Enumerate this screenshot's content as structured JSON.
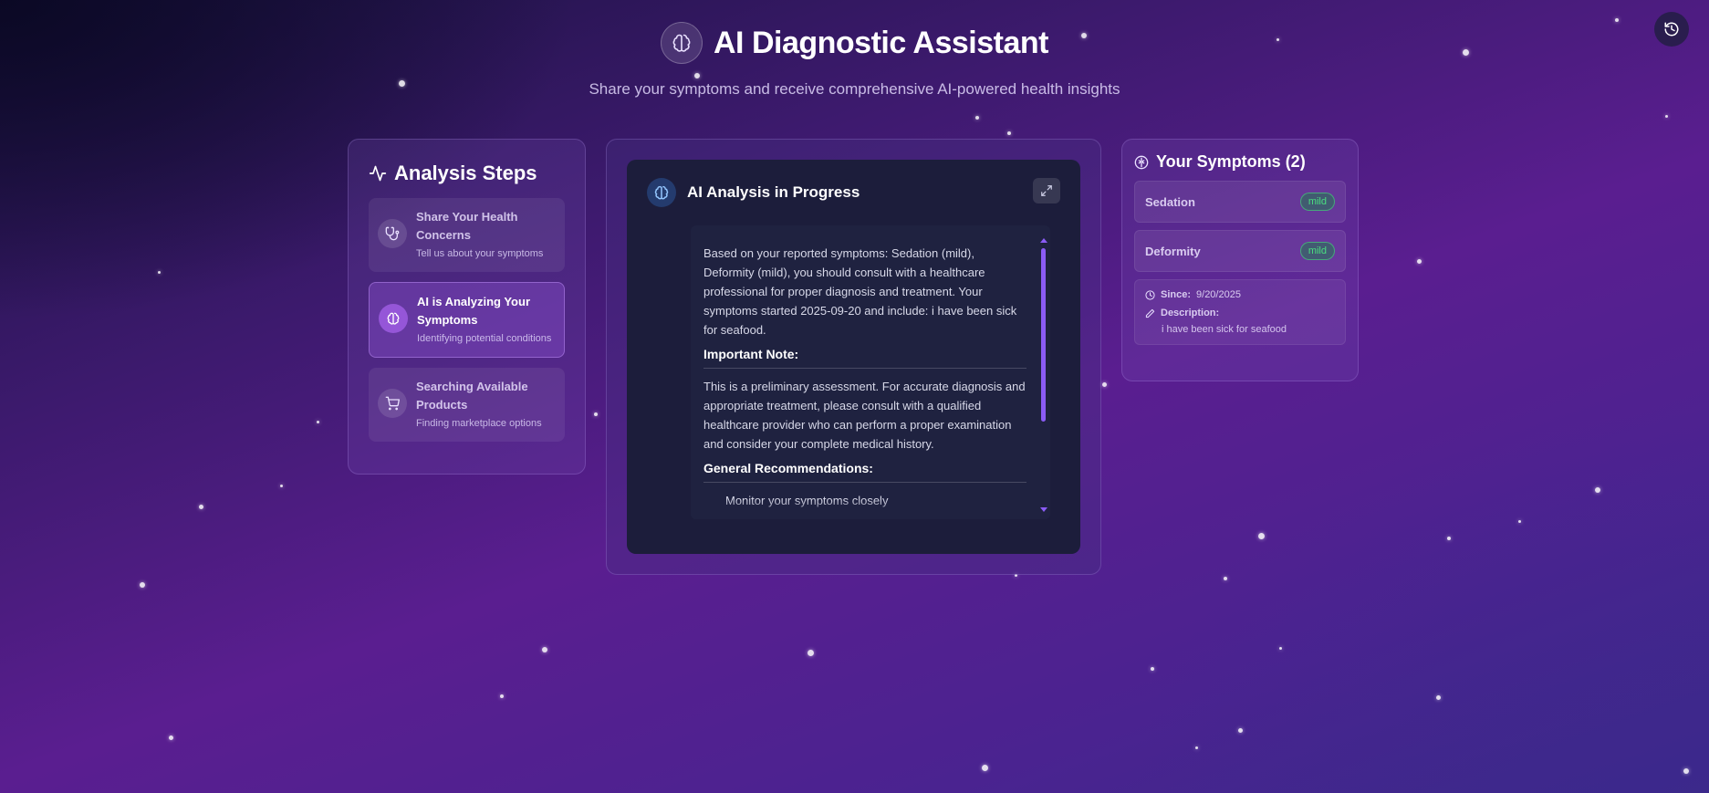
{
  "header": {
    "title": "AI Diagnostic Assistant",
    "subtitle": "Share your symptoms and receive comprehensive AI-powered health insights",
    "icon": "brain-icon"
  },
  "history_button": {
    "icon": "history-icon"
  },
  "steps": {
    "title": "Analysis Steps",
    "icon": "activity-icon",
    "items": [
      {
        "title": "Share Your Health Concerns",
        "desc": "Tell us about your symptoms",
        "icon": "stethoscope-icon",
        "active": false
      },
      {
        "title": "AI is Analyzing Your Symptoms",
        "desc": "Identifying potential conditions",
        "icon": "brain-icon",
        "active": true
      },
      {
        "title": "Searching Available Products",
        "desc": "Finding marketplace options",
        "icon": "cart-icon",
        "active": false
      }
    ]
  },
  "analysis": {
    "title": "AI Analysis in Progress",
    "expand_icon": "expand-icon",
    "intro": "Based on your reported symptoms: Sedation (mild), Deformity (mild), you should consult with a healthcare professional for proper diagnosis and treatment. Your symptoms started 2025-09-20 and include: i have been sick for seafood.",
    "note_heading": "Important Note:",
    "note_text": "This is a preliminary assessment. For accurate diagnosis and appropriate treatment, please consult with a qualified healthcare provider who can perform a proper examination and consider your complete medical history.",
    "recs_heading": "General Recommendations:",
    "recs": [
      "Monitor your symptoms closely"
    ]
  },
  "symptoms": {
    "title": "Your Symptoms (2)",
    "icon": "brain-icon",
    "items": [
      {
        "name": "Sedation",
        "severity": "mild"
      },
      {
        "name": "Deformity",
        "severity": "mild"
      }
    ],
    "since_label": "Since:",
    "since_value": "9/20/2025",
    "description_label": "Description:",
    "description_value": "i have been sick for seafood"
  },
  "colors": {
    "accent": "#8b5cf6",
    "severity_mild": "#4ade80"
  }
}
